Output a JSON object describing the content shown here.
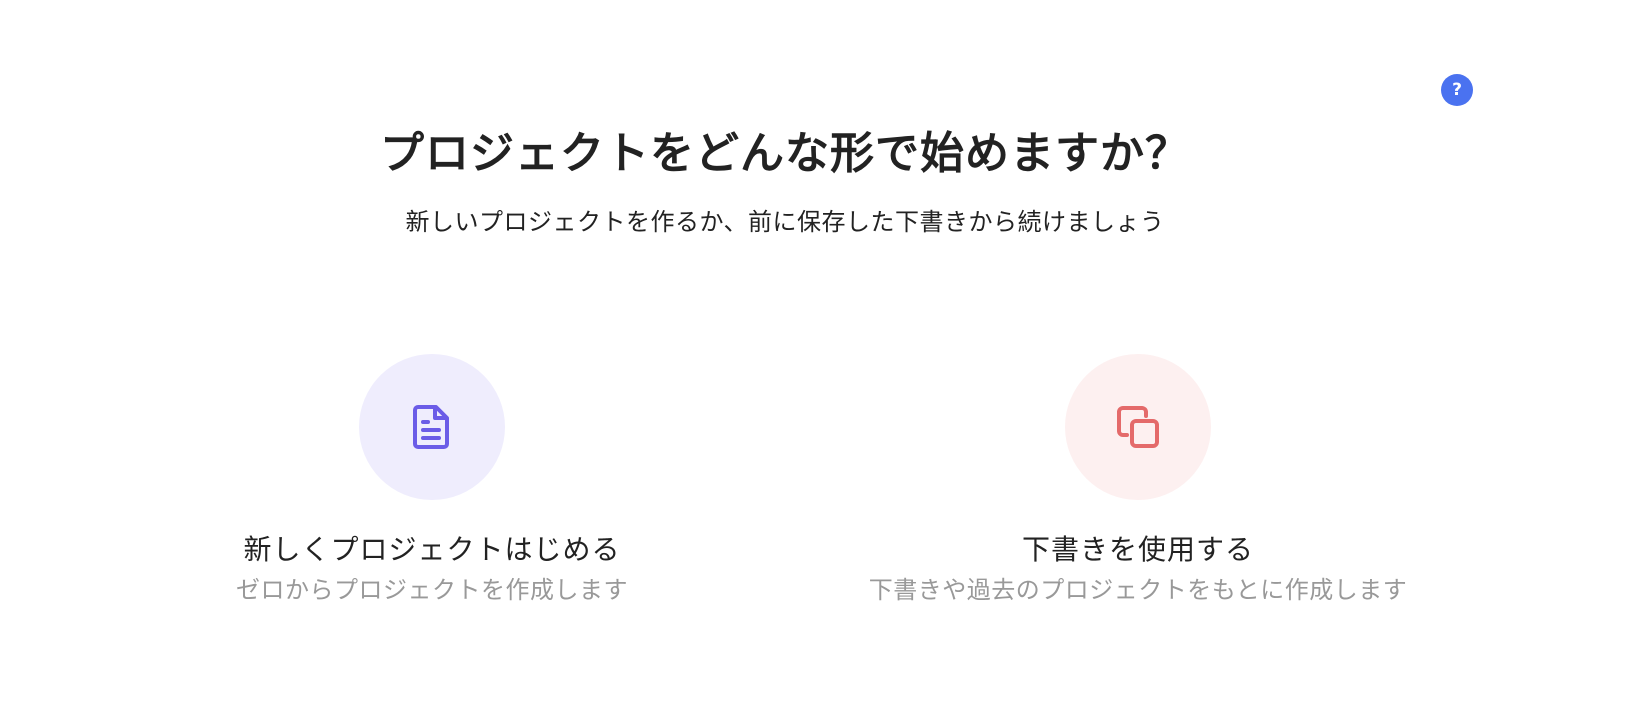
{
  "help": {
    "label": "?",
    "color": "#4a72f0"
  },
  "header": {
    "title": "プロジェクトをどんな形で始めますか？",
    "subtitle": "新しいプロジェクトを作るか、前に保存した下書きから続けましょう"
  },
  "options": [
    {
      "icon": "document-icon",
      "title": "新しくプロジェクトはじめる",
      "description": "ゼロからプロジェクトを作成します",
      "accent": "#6b5ce7",
      "background": "#efedfd"
    },
    {
      "icon": "copy-icon",
      "title": "下書きを使用する",
      "description": "下書きや過去のプロジェクトをもとに作成します",
      "accent": "#e46a6a",
      "background": "#fdf0f0"
    }
  ]
}
